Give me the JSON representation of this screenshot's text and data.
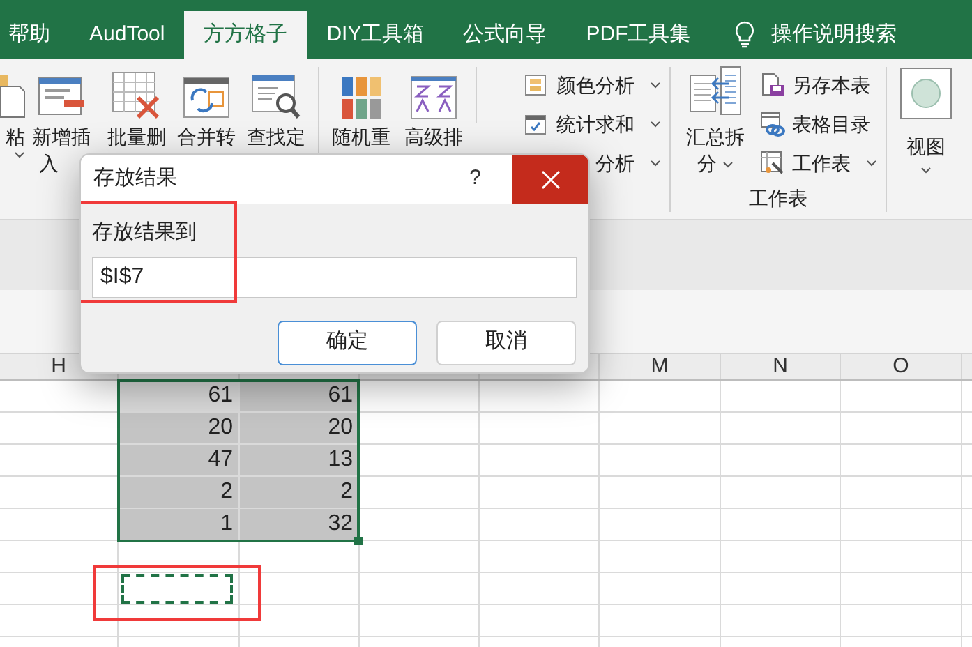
{
  "tabs": [
    {
      "label": "帮助",
      "selected": false
    },
    {
      "label": "AudTool",
      "selected": false
    },
    {
      "label": "方方格子",
      "selected": true
    },
    {
      "label": "DIY工具箱",
      "selected": false
    },
    {
      "label": "公式向导",
      "selected": false
    },
    {
      "label": "PDF工具集",
      "selected": false
    }
  ],
  "search": {
    "label": "操作说明搜索"
  },
  "ribbon": {
    "large_buttons_a": [
      {
        "lines": [
          "粘"
        ],
        "dropdown": true
      },
      {
        "lines": [
          "新增插",
          "入"
        ],
        "dropdown": false
      },
      {
        "lines": [
          "批量删"
        ],
        "dropdown": false
      },
      {
        "lines": [
          "合并转"
        ],
        "dropdown": false
      },
      {
        "lines": [
          "查找定"
        ],
        "dropdown": false
      }
    ],
    "large_buttons_b": [
      {
        "lines": [
          "随机重"
        ],
        "dropdown": false
      },
      {
        "lines": [
          "高级排"
        ],
        "dropdown": false
      }
    ],
    "small_buttons_a": [
      {
        "label": "颜色分析",
        "dropdown": true
      },
      {
        "label": "统计求和",
        "dropdown": true
      },
      {
        "label": "分析",
        "dropdown": true
      }
    ],
    "worksheet_group": {
      "large_button": {
        "lines": [
          "汇总拆",
          "分"
        ],
        "dropdown": true
      },
      "small_buttons": [
        {
          "label": "另存本表",
          "dropdown": false
        },
        {
          "label": "表格目录",
          "dropdown": false
        },
        {
          "label": "工作表",
          "dropdown": true
        }
      ],
      "label": "工作表"
    },
    "view_button": {
      "label": "视图",
      "dropdown": true
    }
  },
  "sheet": {
    "columns_left": [
      "H"
    ],
    "columns_right": [
      "M",
      "N",
      "O"
    ],
    "rows": [
      {
        "values": [
          "61",
          "61"
        ],
        "selected": true
      },
      {
        "values": [
          "20",
          "20"
        ],
        "selected": true
      },
      {
        "values": [
          "47",
          "13"
        ],
        "selected": true
      },
      {
        "values": [
          "2",
          "2"
        ],
        "selected": true
      },
      {
        "values": [
          "1",
          "32"
        ],
        "selected": true
      }
    ],
    "copy_marquee": true
  },
  "dialog": {
    "title": "存放结果",
    "help": "?",
    "field_label": "存放结果到",
    "field_value": "$I$7",
    "buttons": [
      {
        "label": "确定",
        "kind": "default"
      },
      {
        "label": "取消",
        "kind": "normal"
      }
    ]
  }
}
